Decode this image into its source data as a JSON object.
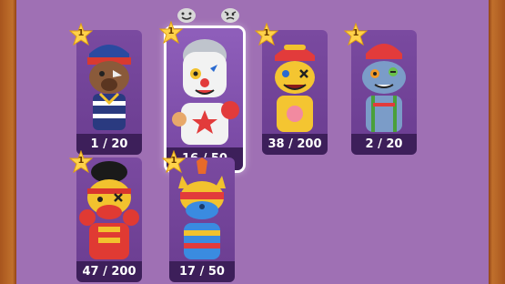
{
  "cards": [
    {
      "id": "bear-pirate",
      "count": "1 / 20",
      "star_level": "1",
      "colors": {
        "body": "#8a5a3a",
        "hat": "#2a4aa0",
        "accent": "#d83a30"
      }
    },
    {
      "id": "clown",
      "count": "16 / 50",
      "star_level": "1",
      "selected": true,
      "colors": {
        "body": "#f2f2f2",
        "hat": "#bfc4cc",
        "accent": "#e23b3b"
      }
    },
    {
      "id": "yellow-dog",
      "count": "38 / 200",
      "star_level": "1",
      "colors": {
        "body": "#f4c531",
        "hat": "#e23b3b",
        "accent": "#2a6ad0"
      }
    },
    {
      "id": "blue-bear",
      "count": "2 / 20",
      "star_level": "1",
      "colors": {
        "body": "#7b9cc8",
        "hat": "#e23b3b",
        "accent": "#f39a2a"
      }
    },
    {
      "id": "red-bulldog",
      "count": "47 / 200",
      "star_level": "1",
      "colors": {
        "body": "#e03a33",
        "hat": "#1a1a1a",
        "accent": "#f2c22e"
      }
    },
    {
      "id": "cat-mohawk",
      "count": "17 / 50",
      "star_level": "1",
      "colors": {
        "body": "#3a8be0",
        "hat": "#e86a2a",
        "accent": "#f2c22e"
      }
    }
  ],
  "top_icons": [
    {
      "name": "happy-face-icon"
    },
    {
      "name": "angry-face-icon"
    }
  ]
}
